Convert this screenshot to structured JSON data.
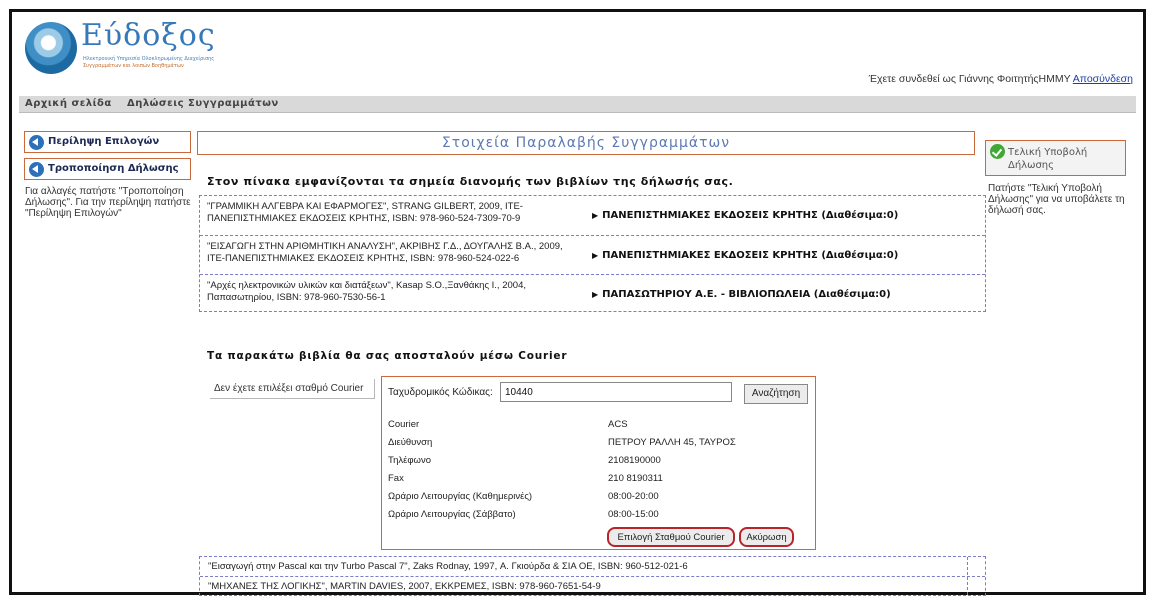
{
  "header": {
    "logo_text": "Εύδοξος",
    "logo_sub1": "Ηλεκτρονική Υπηρεσία Ολοκληρωμένης Διαχείρισης",
    "logo_sub2": "Συγγραμμάτων και λοιπών Βοηθημάτων",
    "user_text": "Έχετε συνδεθεί ως Γιάννης ΦοιτητήςΗΜΜΥ",
    "logout_label": "Αποσύνδεση"
  },
  "menu": {
    "home": "Αρχική σελίδα",
    "declarations": "Δηλώσεις Συγγραμμάτων"
  },
  "left": {
    "summary_label": "Περίληψη Επιλογών",
    "modify_label": "Τροποποίηση Δήλωσης",
    "help_text": "Για αλλαγές πατήστε \"Τροποποίηση Δήλωσης\". Για την περίληψη πατήστε \"Περίληψη Επιλογών\""
  },
  "center": {
    "title": "Στοιχεία Παραλαβής Συγγραμμάτων",
    "intro": "Στον πίνακα εμφανίζονται τα σημεία διανομής των βιβλίων της δήλωσής σας.",
    "books": [
      {
        "desc": "\"ΓΡΑΜΜΙΚΗ ΑΛΓΕΒΡΑ ΚΑΙ ΕΦΑΡΜΟΓΕΣ\", STRANG GILBERT, 2009, ΙΤΕ-ΠΑΝΕΠΙΣΤΗΜΙΑΚΕΣ ΕΚΔΟΣΕΙΣ ΚΡΗΤΗΣ, ISBN: 978-960-524-7309-70-9",
        "publisher": "ΠΑΝΕΠΙΣΤΗΜΙΑΚΕΣ ΕΚΔΟΣΕΙΣ ΚΡΗΤΗΣ (Διαθέσιμα:0)"
      },
      {
        "desc": "\"ΕΙΣΑΓΩΓΗ ΣΤΗΝ ΑΡΙΘΜΗΤΙΚΗ ΑΝΑΛΥΣΗ\", ΑΚΡΙΒΗΣ Γ.Δ., ΔΟΥΓΑΛΗΣ Β.Α., 2009, ΙΤΕ-ΠΑΝΕΠΙΣΤΗΜΙΑΚΕΣ ΕΚΔΟΣΕΙΣ ΚΡΗΤΗΣ, ISBN: 978-960-524-022-6",
        "publisher": "ΠΑΝΕΠΙΣΤΗΜΙΑΚΕΣ ΕΚΔΟΣΕΙΣ ΚΡΗΤΗΣ (Διαθέσιμα:0)"
      },
      {
        "desc": "\"Αρχές ηλεκτρονικών υλικών και διατάξεων\", Kasap S.O.,Ξανθάκης Ι., 2004, Παπασωτηρίου, ISBN: 978-960-7530-56-1",
        "publisher": "ΠΑΠΑΣΩΤΗΡΙΟΥ Α.Ε. - ΒΙΒΛΙΟΠΩΛΕΙΑ (Διαθέσιμα:0)"
      }
    ],
    "courier_heading": "Τα παρακάτω βιβλία θα σας αποσταλούν μέσω Courier",
    "no_station": "Δεν έχετε επιλέξει σταθμό Courier",
    "courier_box": {
      "postal_code_label": "Ταχυδρομικός Κώδικας:",
      "postal_code_value": "10440",
      "search_label": "Αναζήτηση",
      "rows": [
        {
          "k": "Courier",
          "v": "ACS"
        },
        {
          "k": "Διεύθυνση",
          "v": "ΠΕΤΡΟΥ ΡΑΛΛΗ 45, ΤΑΥΡΟΣ"
        },
        {
          "k": "Τηλέφωνο",
          "v": "2108190000"
        },
        {
          "k": "Fax",
          "v": "210 8190311"
        },
        {
          "k": "Ωράριο Λειτουργίας (Καθημερινές)",
          "v": "08:00-20:00"
        },
        {
          "k": "Ωράριο Λειτουργίας (Σάββατο)",
          "v": "08:00-15:00"
        }
      ],
      "pick_label": "Επιλογή Σταθμού Courier",
      "cancel_label": "Ακύρωση"
    },
    "courier_books": [
      "\"Εισαγωγή στην Pascal και την Turbo Pascal 7\", Zaks Rodnay, 1997, Α. Γκιούρδα & ΣΙΑ ΟΕ, ISBN: 960-512-021-6",
      "\"ΜΗΧΑΝΕΣ ΤΗΣ ΛΟΓΙΚΗΣ\", MARTIN DAVIES, 2007, ΕΚΚΡΕΜΕΣ, ISBN: 978-960-7651-54-9"
    ]
  },
  "right": {
    "final_label": "Τελική Υποβολή Δήλωσης",
    "help_text": "Πατήστε \"Τελική Υποβολή Δήλωσης\" για να υποβάλετε τη δήλωσή σας."
  },
  "colors": {
    "accent_border": "#c9693c",
    "title_blue": "#5d7ab4",
    "highlight_red": "#b8242a"
  }
}
